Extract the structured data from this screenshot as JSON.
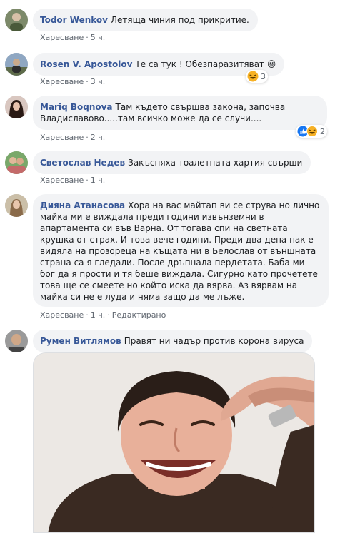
{
  "comments": [
    {
      "author": "Todor Wenkov",
      "text": "Летяща чиния под прикритие.",
      "like_label": "Харесване",
      "separator": "·",
      "time": "5 ч."
    },
    {
      "author": "Rosen V. Apostolov",
      "text": "Те са тук ! Обезпаразитяват 😜",
      "like_label": "Харесване",
      "separator": "·",
      "time": "3 ч.",
      "reaction_count": "3",
      "reaction_icon": "haha-icon"
    },
    {
      "author": "Mariq Boqnova",
      "text": "Там където свършва закона, започва Владиславово.....там всичко може да се случи....",
      "like_label": "Харесване",
      "separator": "·",
      "time": "2 ч.",
      "reaction_count": "2",
      "reaction_icons": [
        "like-icon",
        "haha-icon"
      ]
    },
    {
      "author": "Светослав Недев",
      "text": "Закъсняха тоалетната хартия свърши",
      "like_label": "Харесване",
      "separator": "·",
      "time": "1 ч."
    },
    {
      "author": "Дияна Атанасова",
      "text": "Хора на вас майтап ви се струва но лично майка ми е виждала преди години извънземни в апартамента си във Варна. От тогава спи на светната крушка от страх. И това вече години. Преди два дена пак е видяла на прозореца на къщата ни в Белослав от външната страна са я гледали. После дръпнала пердетата. Баба ми бог да я прости и тя беше виждала. Сигурно като прочетете това ще се смеете но който иска да вярва. Аз вярвам на майка си не е луда и няма защо да ме лъже.",
      "like_label": "Харесване",
      "separator": "·",
      "time": "1 ч.",
      "edited_label": "Редактирано"
    },
    {
      "author": "Румен Витлямов",
      "text": "Правят ни чадър против корона вируса",
      "image_icon": "laughing-man-photo"
    }
  ],
  "colors": {
    "author": "#385898",
    "bubble_bg": "#f2f3f5",
    "meta": "#606770",
    "like_blue": "#1877f2",
    "haha_yellow": "#f7b125"
  }
}
